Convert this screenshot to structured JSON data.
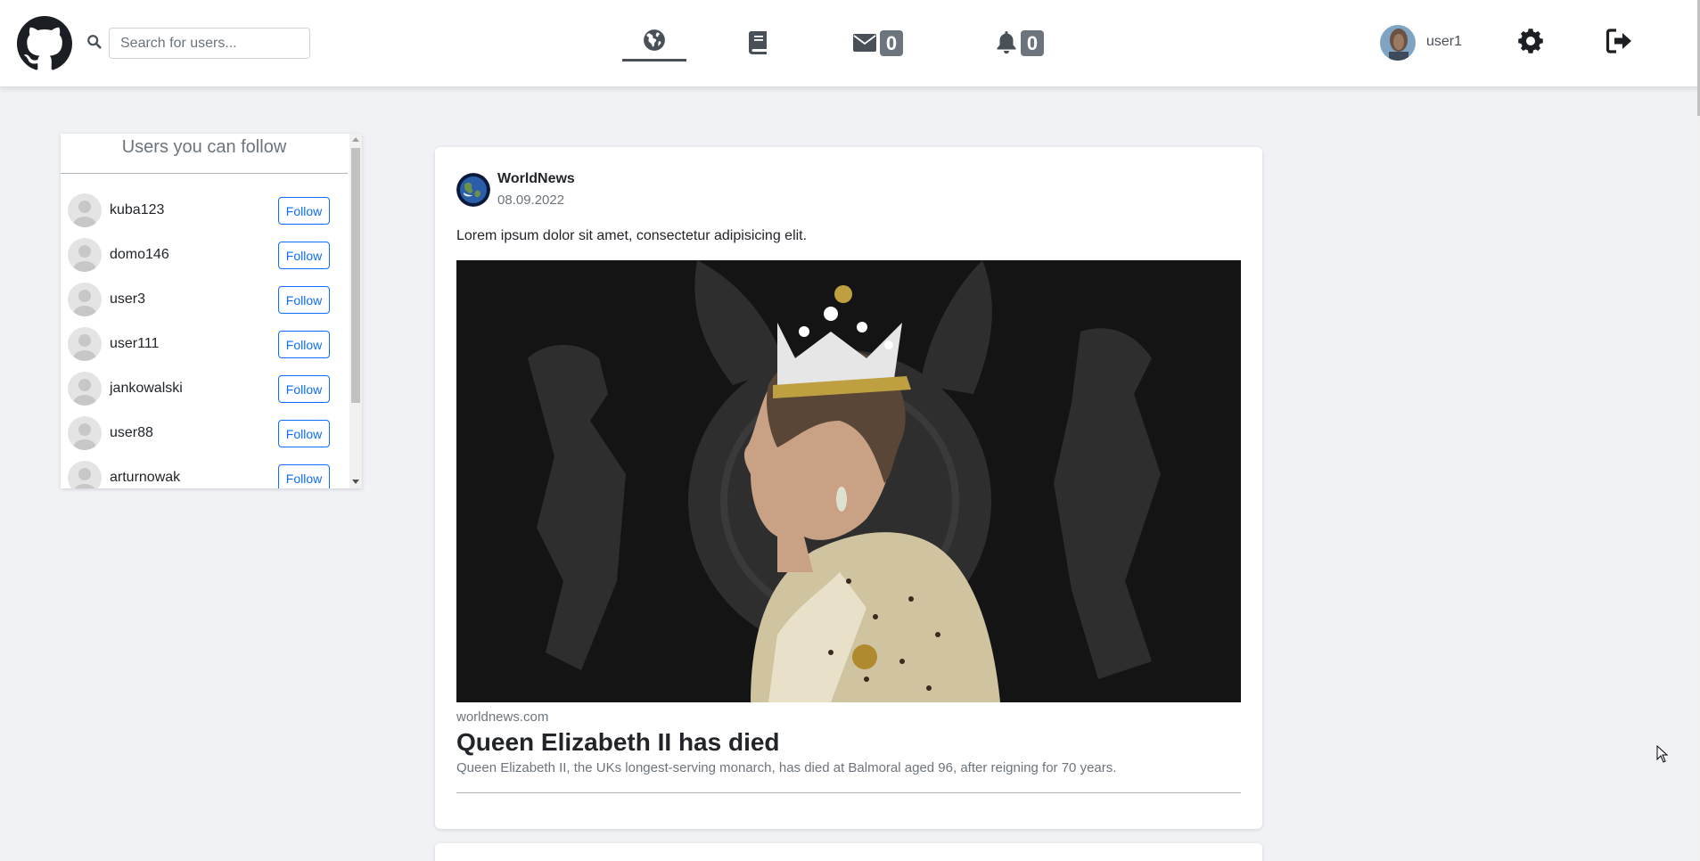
{
  "header": {
    "logo_icon": "github-icon",
    "search": {
      "placeholder": "Search for users...",
      "value": ""
    },
    "nav": {
      "home_icon": "globe-icon",
      "book_icon": "book-icon",
      "messages_icon": "envelope-icon",
      "messages_count": "0",
      "notifications_icon": "bell-icon",
      "notifications_count": "0"
    },
    "user": {
      "name": "user1"
    },
    "settings_icon": "gear-icon",
    "logout_icon": "sign-out-icon"
  },
  "follow_panel": {
    "title": "Users you can follow",
    "follow_label": "Follow",
    "users": [
      {
        "name": "kuba123"
      },
      {
        "name": "domo146"
      },
      {
        "name": "user3"
      },
      {
        "name": "user111"
      },
      {
        "name": "jankowalski"
      },
      {
        "name": "user88"
      },
      {
        "name": "arturnowak"
      }
    ]
  },
  "post": {
    "author": "WorldNews",
    "date": "08.09.2022",
    "text": "Lorem ipsum dolor sit amet, consectetur adipisicing elit.",
    "link": {
      "domain": "worldnews.com",
      "title": "Queen Elizabeth II has died",
      "description": "Queen Elizabeth II, the UKs longest-serving monarch, has died at Balmoral aged 96, after reigning for 70 years."
    }
  },
  "colors": {
    "accent": "#0d6efd",
    "badge": "#6c757d",
    "background": "#f0f2f5"
  }
}
